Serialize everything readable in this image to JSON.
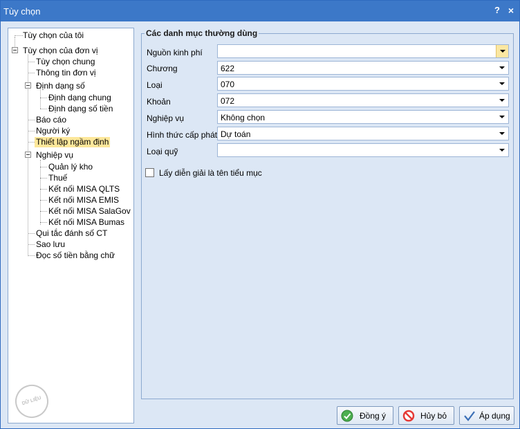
{
  "window": {
    "title": "Tùy chọn",
    "help_label": "?",
    "close_label": "×"
  },
  "tree": {
    "items": [
      {
        "label": "Tùy chọn của tôi"
      },
      {
        "label": "Tùy chọn của đơn vị"
      },
      {
        "label": "Tùy chọn chung"
      },
      {
        "label": "Thông tin đơn vị"
      },
      {
        "label": "Định dạng số"
      },
      {
        "label": "Định dạng chung"
      },
      {
        "label": "Định dạng số tiền"
      },
      {
        "label": "Báo cáo"
      },
      {
        "label": "Người ký"
      },
      {
        "label": "Thiết lập ngầm định"
      },
      {
        "label": "Nghiệp vụ"
      },
      {
        "label": "Quản lý kho"
      },
      {
        "label": "Thuế"
      },
      {
        "label": "Kết nối MISA QLTS"
      },
      {
        "label": "Kết nối MISA EMIS"
      },
      {
        "label": "Kết nối MISA SalaGov"
      },
      {
        "label": "Kết nối MISA Bumas"
      },
      {
        "label": "Qui tắc đánh số CT"
      },
      {
        "label": "Sao lưu"
      },
      {
        "label": "Đọc số tiền bằng chữ"
      }
    ],
    "selected_index": 9
  },
  "watermark": {
    "text": "DỮ LIỆU MẪU"
  },
  "group": {
    "title": "Các danh mục thường dùng",
    "fields": [
      {
        "label": "Nguồn kinh phí",
        "value": ""
      },
      {
        "label": "Chương",
        "value": "622"
      },
      {
        "label": "Loại",
        "value": "070"
      },
      {
        "label": "Khoản",
        "value": "072"
      },
      {
        "label": "Nghiệp vụ",
        "value": "Không chọn"
      },
      {
        "label": "Hình thức cấp phát",
        "value": "Dự toán"
      },
      {
        "label": "Loại quỹ",
        "value": ""
      }
    ],
    "checkbox": {
      "label": "Lấy diễn giải là tên tiểu mục",
      "checked": false
    }
  },
  "buttons": {
    "ok": "Đồng ý",
    "cancel": "Hủy bỏ",
    "apply": "Áp dụng"
  },
  "colors": {
    "accent": "#3c78c8",
    "selection": "#fde79a",
    "background": "#dce7f5"
  }
}
